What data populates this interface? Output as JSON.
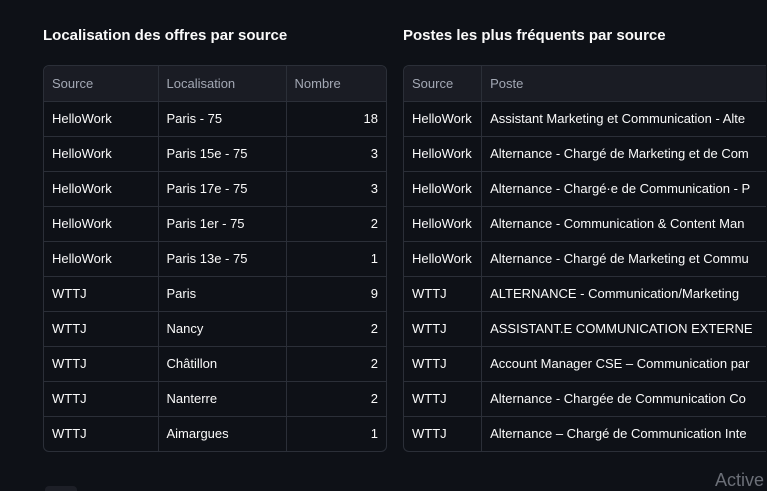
{
  "left_table": {
    "title": "Localisation des offres par source",
    "columns": [
      "Source",
      "Localisation",
      "Nombre"
    ],
    "rows": [
      [
        "HelloWork",
        "Paris - 75",
        "18"
      ],
      [
        "HelloWork",
        "Paris 15e - 75",
        "3"
      ],
      [
        "HelloWork",
        "Paris 17e - 75",
        "3"
      ],
      [
        "HelloWork",
        "Paris 1er - 75",
        "2"
      ],
      [
        "HelloWork",
        "Paris 13e - 75",
        "1"
      ],
      [
        "WTTJ",
        "Paris",
        "9"
      ],
      [
        "WTTJ",
        "Nancy",
        "2"
      ],
      [
        "WTTJ",
        "Châtillon",
        "2"
      ],
      [
        "WTTJ",
        "Nanterre",
        "2"
      ],
      [
        "WTTJ",
        "Aimargues",
        "1"
      ]
    ]
  },
  "right_table": {
    "title": "Postes les plus fréquents par source",
    "columns": [
      "Source",
      "Poste"
    ],
    "rows": [
      [
        "HelloWork",
        "Assistant Marketing et Communication - Alte"
      ],
      [
        "HelloWork",
        "Alternance - Chargé de Marketing et de Com"
      ],
      [
        "HelloWork",
        "Alternance - Chargé·e de Communication - P"
      ],
      [
        "HelloWork",
        "Alternance - Communication & Content Man"
      ],
      [
        "HelloWork",
        "Alternance - Chargé de Marketing et Commu"
      ],
      [
        "WTTJ",
        "ALTERNANCE - Communication/Marketing"
      ],
      [
        "WTTJ",
        "ASSISTANT.E COMMUNICATION EXTERNE"
      ],
      [
        "WTTJ",
        "Account Manager CSE – Communication par"
      ],
      [
        "WTTJ",
        "Alternance - Chargée de Communication Co"
      ],
      [
        "WTTJ",
        "Alternance – Chargé de Communication Inte"
      ]
    ]
  },
  "watermark": "Active",
  "colors": {
    "background": "#0e1117",
    "border": "#2b2f38",
    "header_bg": "#1a1c24",
    "header_text": "#a3a8b4",
    "text": "#fafafa"
  }
}
